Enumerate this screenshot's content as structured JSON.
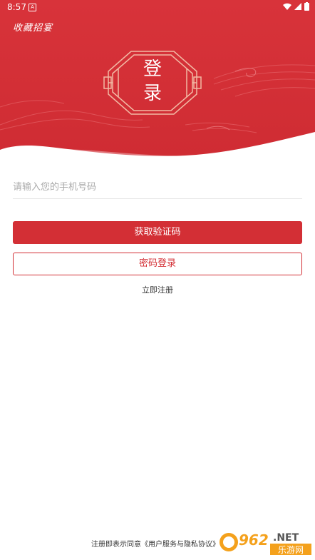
{
  "status_bar": {
    "time": "8:57",
    "notification_glyph": "A"
  },
  "header": {
    "app_title": "收藏招宴",
    "badge_line1": "登",
    "badge_line2": "录",
    "brand_color": "#d32f35"
  },
  "form": {
    "phone_placeholder": "请输入您的手机号码",
    "get_code_label": "获取验证码",
    "password_login_label": "密码登录",
    "register_label": "立即注册"
  },
  "footer": {
    "agreement_text": "注册即表示同意《用户服务与隐私协议》"
  },
  "watermark": {
    "digits": "962",
    "suffix": ".NET",
    "caption": "乐游网"
  }
}
